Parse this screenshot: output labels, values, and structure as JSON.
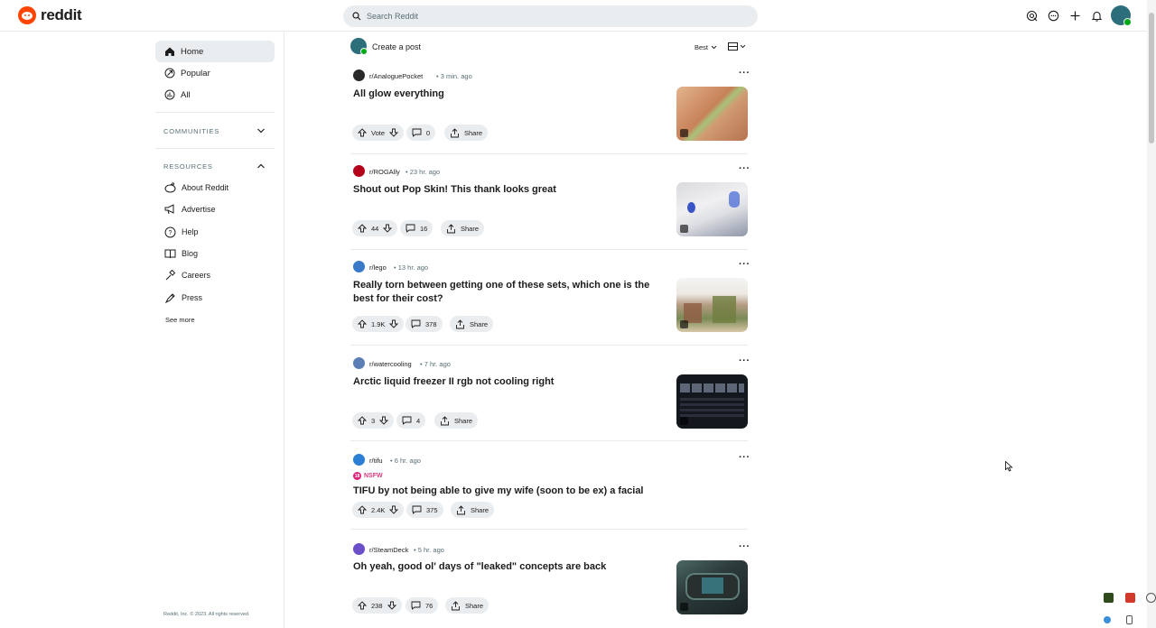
{
  "header": {
    "logo_text": "reddit",
    "search_placeholder": "Search Reddit",
    "icons": [
      "advertise-icon",
      "chat-icon",
      "create-plus-icon",
      "notification-bell-icon",
      "user-avatar"
    ]
  },
  "sidebar": {
    "nav": [
      {
        "label": "Home",
        "icon": "home-icon",
        "active": true
      },
      {
        "label": "Popular",
        "icon": "popular-icon",
        "active": false
      },
      {
        "label": "All",
        "icon": "all-icon",
        "active": false
      }
    ],
    "communities_title": "COMMUNITIES",
    "resources_title": "RESOURCES",
    "resources": [
      {
        "label": "About Reddit",
        "icon": "about-reddit-icon"
      },
      {
        "label": "Advertise",
        "icon": "advertise-icon"
      },
      {
        "label": "Help",
        "icon": "help-icon"
      },
      {
        "label": "Blog",
        "icon": "blog-icon"
      },
      {
        "label": "Careers",
        "icon": "careers-icon"
      },
      {
        "label": "Press",
        "icon": "press-icon"
      }
    ],
    "see_more": "See more",
    "copyright": "Reddit, Inc. © 2023. All rights reserved."
  },
  "feed": {
    "create_post": "Create a post",
    "sort": "Best",
    "posts": [
      {
        "sub": "r/AnaloguePocket",
        "time": "3 min. ago",
        "title": "All glow everything",
        "votes": "Vote",
        "comments": "0",
        "share": "Share",
        "sub_color": "#2a2a2a",
        "thumb_colors": [
          "#d9a079",
          "#c07a52",
          "#8aa86b"
        ]
      },
      {
        "sub": "r/ROGAlly",
        "time": "23 hr. ago",
        "title": "Shout out Pop Skin! This thank looks great",
        "votes": "44",
        "comments": "16",
        "share": "Share",
        "sub_color": "#b3001b",
        "thumb_colors": [
          "#e8e8ea",
          "#c9cbd0",
          "#4a63c8"
        ]
      },
      {
        "sub": "r/lego",
        "time": "13 hr. ago",
        "title": "Really torn between getting one of these sets, which one is the best for their cost?",
        "votes": "1.9K",
        "comments": "378",
        "share": "Share",
        "sub_color": "#3a78c8",
        "thumb_colors": [
          "#f2f2f2",
          "#b9a38d",
          "#6b7b4a"
        ]
      },
      {
        "sub": "r/watercooling",
        "time": "7 hr. ago",
        "title": "Arctic liquid freezer II rgb not cooling right",
        "votes": "3",
        "comments": "4",
        "share": "Share",
        "sub_color": "#5b7fb5",
        "thumb_colors": [
          "#1a1c24",
          "#4d5666",
          "#9aa3b0"
        ]
      },
      {
        "sub": "r/tifu",
        "time": "6 hr. ago",
        "nsfw": "NSFW",
        "title": "TIFU by not being able to give my wife (soon to be ex) a facial",
        "votes": "2.4K",
        "comments": "375",
        "share": "Share",
        "sub_color": "#2b7fd4"
      },
      {
        "sub": "r/SteamDeck",
        "time": "5 hr. ago",
        "title": "Oh yeah, good ol' days of \"leaked\" concepts are back",
        "votes": "238",
        "comments": "76",
        "share": "Share",
        "sub_color": "#6a4fc9",
        "thumb_colors": [
          "#2c3a3a",
          "#5e7d78",
          "#1b2424"
        ]
      }
    ]
  },
  "colors": {
    "brand": "#ff4500",
    "pill_bg": "#eaedef",
    "nsfw": "#d93a80",
    "online": "#01a816"
  }
}
